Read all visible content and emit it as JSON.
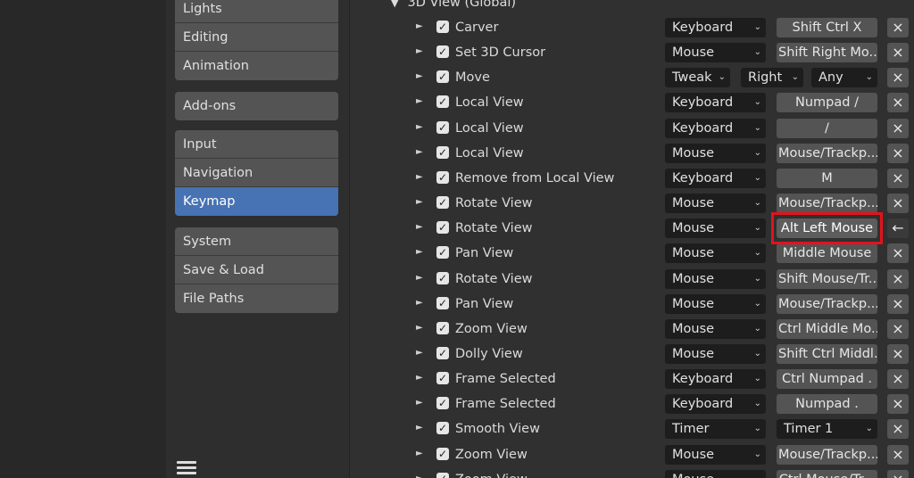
{
  "sidebar": {
    "groups": [
      [
        "Lights",
        "Editing",
        "Animation"
      ],
      [
        "Add-ons"
      ],
      [
        "Input",
        "Navigation",
        "Keymap"
      ],
      [
        "System",
        "Save & Load",
        "File Paths"
      ]
    ],
    "active": "Keymap"
  },
  "section": {
    "title": "3D View (Global)"
  },
  "rows": [
    {
      "name": "Carver",
      "type": "Keyboard",
      "key": "Shift Ctrl X"
    },
    {
      "name": "Set 3D Cursor",
      "type": "Mouse",
      "key": "Shift Right Mo..."
    },
    {
      "name": "Move",
      "type": "Tweak",
      "key": "",
      "tweak_dir": "Right",
      "tweak_val": "Any"
    },
    {
      "name": "Local View",
      "type": "Keyboard",
      "key": "Numpad /"
    },
    {
      "name": "Local View",
      "type": "Keyboard",
      "key": "/"
    },
    {
      "name": "Local View",
      "type": "Mouse",
      "key": "Mouse/Trackp..."
    },
    {
      "name": "Remove from Local View",
      "type": "Keyboard",
      "key": "M"
    },
    {
      "name": "Rotate View",
      "type": "Mouse",
      "key": "Mouse/Trackp..."
    },
    {
      "name": "Rotate View",
      "type": "Mouse",
      "key": "Alt Left Mouse",
      "highlighted": true
    },
    {
      "name": "Pan View",
      "type": "Mouse",
      "key": "Middle Mouse"
    },
    {
      "name": "Rotate View",
      "type": "Mouse",
      "key": "Shift Mouse/Tr..."
    },
    {
      "name": "Pan View",
      "type": "Mouse",
      "key": "Mouse/Trackp..."
    },
    {
      "name": "Zoom View",
      "type": "Mouse",
      "key": "Ctrl Middle Mo..."
    },
    {
      "name": "Dolly View",
      "type": "Mouse",
      "key": "Shift Ctrl Middl..."
    },
    {
      "name": "Frame Selected",
      "type": "Keyboard",
      "key": "Ctrl Numpad ."
    },
    {
      "name": "Frame Selected",
      "type": "Keyboard",
      "key": "Numpad ."
    },
    {
      "name": "Smooth View",
      "type": "Timer",
      "key": "Timer 1",
      "key_is_dropdown": true
    },
    {
      "name": "Zoom View",
      "type": "Mouse",
      "key": "Mouse/Trackp..."
    },
    {
      "name": "Zoom View",
      "type": "Mouse",
      "key": "Ctrl Mouse/Tr..."
    }
  ],
  "icons": {
    "remove": "×",
    "arrow": "←",
    "check": "✓",
    "expand": "►",
    "collapse": "▼",
    "dropdown": "⌄"
  },
  "colors": {
    "active_nav": "#4772b3",
    "highlight_box": "#e3131b"
  }
}
